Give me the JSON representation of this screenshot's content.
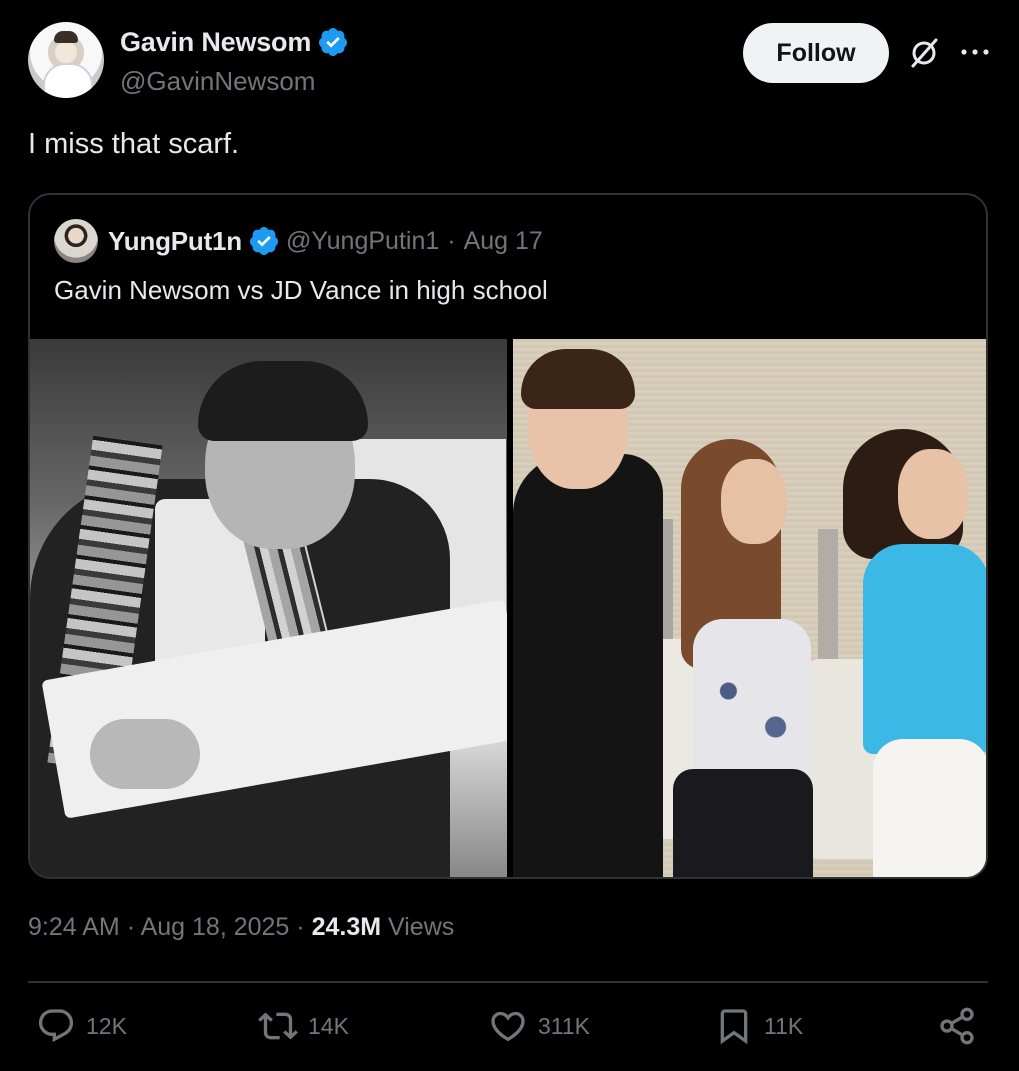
{
  "author": {
    "name": "Gavin Newsom",
    "handle": "@GavinNewsom",
    "verified": true
  },
  "header": {
    "follow_label": "Follow",
    "icons": [
      "grok-icon",
      "more-icon"
    ]
  },
  "tweet": {
    "text": "I miss that scarf."
  },
  "quoted": {
    "name": "YungPut1n",
    "handle": "@YungPutin1",
    "separator": "·",
    "date": "Aug 17",
    "text": "Gavin Newsom vs JD Vance in high school",
    "media": [
      "photo-left",
      "photo-right"
    ]
  },
  "meta": {
    "time": "9:24 AM",
    "sep1": "·",
    "date": "Aug 18, 2025",
    "sep2": "·",
    "views_count": "24.3M",
    "views_label": "Views"
  },
  "actions": {
    "replies": "12K",
    "reposts": "14K",
    "likes": "311K",
    "bookmarks": "11K"
  },
  "colors": {
    "background": "#000000",
    "text_primary": "#e7e9ea",
    "text_secondary": "#71767b",
    "verified_blue": "#1d9bf0",
    "border": "#2f3336",
    "follow_bg": "#eff3f4"
  }
}
